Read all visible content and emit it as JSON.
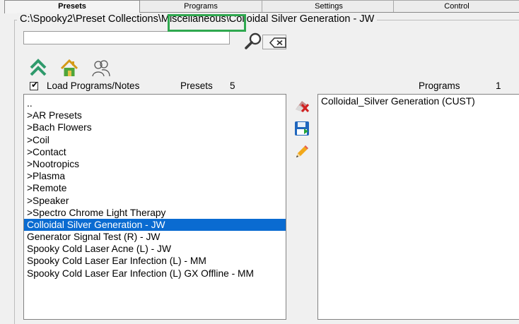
{
  "tabs": [
    {
      "label": "Presets",
      "active": true
    },
    {
      "label": "Programs",
      "active": false
    },
    {
      "label": "Settings",
      "active": false
    },
    {
      "label": "Control",
      "active": false
    }
  ],
  "path": {
    "before": "C:\\Spooky2\\Preset Collections\\",
    "highlighted": "Miscellaneous",
    "after": "\\Colloidal Silver Generation - JW"
  },
  "highlight_color": "#2fa84f",
  "search": {
    "value": "",
    "placeholder": ""
  },
  "icons": {
    "search": "magnifier-icon",
    "clear": "backspace-clear-icon",
    "up": "double-chevron-up-icon",
    "home": "home-icon",
    "users": "users-outline-icon",
    "delete": "eraser-delete-icon",
    "save": "save-disk-icon",
    "edit": "pencil-edit-icon"
  },
  "load_programs": {
    "label": "Load Programs/Notes",
    "checked": true
  },
  "presets_header": {
    "label": "Presets",
    "count": "5"
  },
  "programs_header": {
    "label": "Programs",
    "count": "1"
  },
  "presets_list": [
    "..",
    ">AR Presets",
    ">Bach Flowers",
    ">Coil",
    ">Contact",
    ">Nootropics",
    ">Plasma",
    ">Remote",
    ">Speaker",
    ">Spectro Chrome Light Therapy",
    "Colloidal Silver Generation - JW",
    "Generator Signal Test (R) - JW",
    "Spooky Cold Laser Acne (L) - JW",
    "Spooky Cold Laser Ear Infection (L) - MM",
    "Spooky Cold Laser Ear Infection (L) GX Offline - MM"
  ],
  "selected_preset": "Colloidal Silver Generation - JW",
  "selection_color": "#0a6bd1",
  "programs_list": [
    "Colloidal_Silver Generation (CUST)"
  ]
}
